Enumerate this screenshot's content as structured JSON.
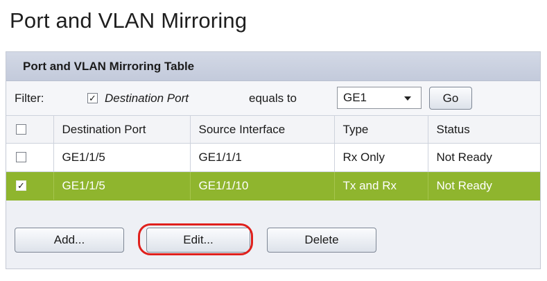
{
  "page": {
    "title": "Port and VLAN Mirroring"
  },
  "panel": {
    "title": "Port and VLAN Mirroring Table"
  },
  "filter": {
    "label": "Filter:",
    "checkbox_checked": true,
    "field": "Destination Port",
    "operator": "equals to",
    "selected_value": "GE1",
    "go_label": "Go"
  },
  "table": {
    "headers": [
      "Destination Port",
      "Source Interface",
      "Type",
      "Status"
    ],
    "rows": [
      {
        "checked": false,
        "destination_port": "GE1/1/5",
        "source_interface": "GE1/1/1",
        "type": "Rx Only",
        "status": "Not Ready"
      },
      {
        "checked": true,
        "destination_port": "GE1/1/5",
        "source_interface": "GE1/1/10",
        "type": "Tx and Rx",
        "status": "Not Ready"
      }
    ]
  },
  "actions": {
    "add_label": "Add...",
    "edit_label": "Edit...",
    "delete_label": "Delete"
  },
  "colors": {
    "selected_row": "#8fb52e",
    "highlight_ring": "#e0201c",
    "header_bg": "#c3cadb"
  },
  "icons": {
    "checkbox": "checkmark-icon",
    "dropdown": "chevron-down-icon"
  }
}
